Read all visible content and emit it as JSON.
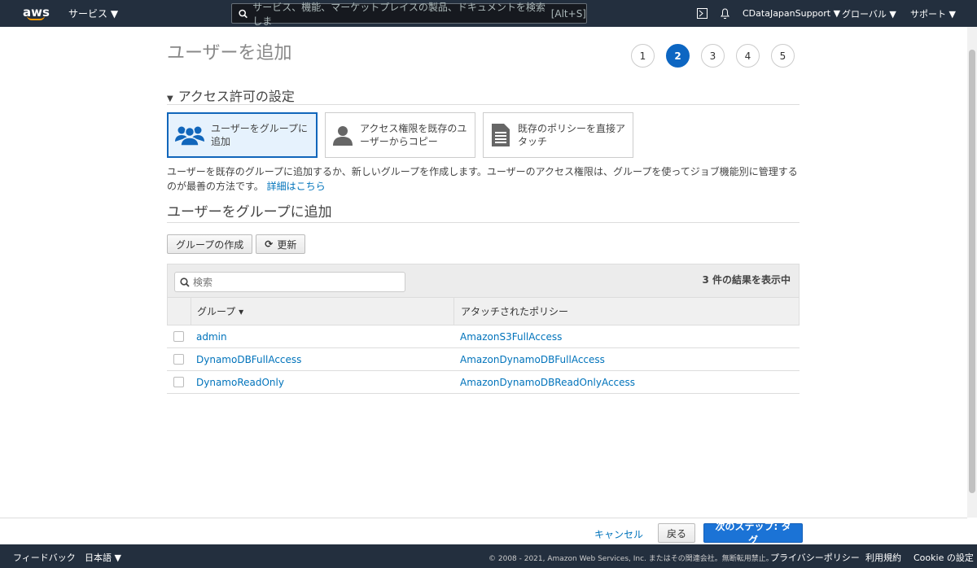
{
  "header": {
    "logo": "aws",
    "services": "サービス ▼",
    "search_placeholder": "サービス、機能、マーケットプレイスの製品、ドキュメントを検索しま",
    "search_shortcut": "[Alt+S]",
    "account": "CDataJapanSupport ▼",
    "region": "グローバル ▼",
    "support": "サポート ▼"
  },
  "page": {
    "title": "ユーザーを追加",
    "steps": [
      "1",
      "2",
      "3",
      "4",
      "5"
    ],
    "active_step": 2,
    "section": "アクセス許可の設定",
    "options": [
      {
        "label": "ユーザーをグループに追加",
        "icon": "users-icon",
        "selected": true
      },
      {
        "label": "アクセス権限を既存のユーザーからコピー",
        "icon": "user-icon"
      },
      {
        "label": "既存のポリシーを直接アタッチ",
        "icon": "document-icon"
      }
    ],
    "description": "ユーザーを既存のグループに追加するか、新しいグループを作成します。ユーザーのアクセス権限は、グループを使ってジョブ機能別に管理するのが最善の方法です。",
    "learn_more": "詳細はこちら",
    "subheading": "ユーザーをグループに追加",
    "create_group": "グループの作成",
    "refresh": "更新"
  },
  "table": {
    "search_placeholder": "検索",
    "result_count": "3 件の結果を表示中",
    "columns": [
      "グループ ▾",
      "アタッチされたポリシー"
    ],
    "rows": [
      {
        "group": "admin",
        "policy": "AmazonS3FullAccess"
      },
      {
        "group": "DynamoDBFullAccess",
        "policy": "AmazonDynamoDBFullAccess"
      },
      {
        "group": "DynamoReadOnly",
        "policy": "AmazonDynamoDBReadOnlyAccess"
      }
    ]
  },
  "actions": {
    "cancel": "キャンセル",
    "back": "戻る",
    "next": "次のステップ: タグ"
  },
  "footer": {
    "feedback": "フィードバック",
    "language": "日本語 ▼",
    "copyright": "© 2008 - 2021, Amazon Web Services, Inc. またはその関連会社。無断転用禁止。",
    "privacy": "プライバシーポリシー",
    "terms": "利用規約",
    "cookie": "Cookie の設定"
  },
  "colors": {
    "accent": "#0d66c2",
    "header_bg": "#232f3e",
    "link": "#0073bb"
  }
}
